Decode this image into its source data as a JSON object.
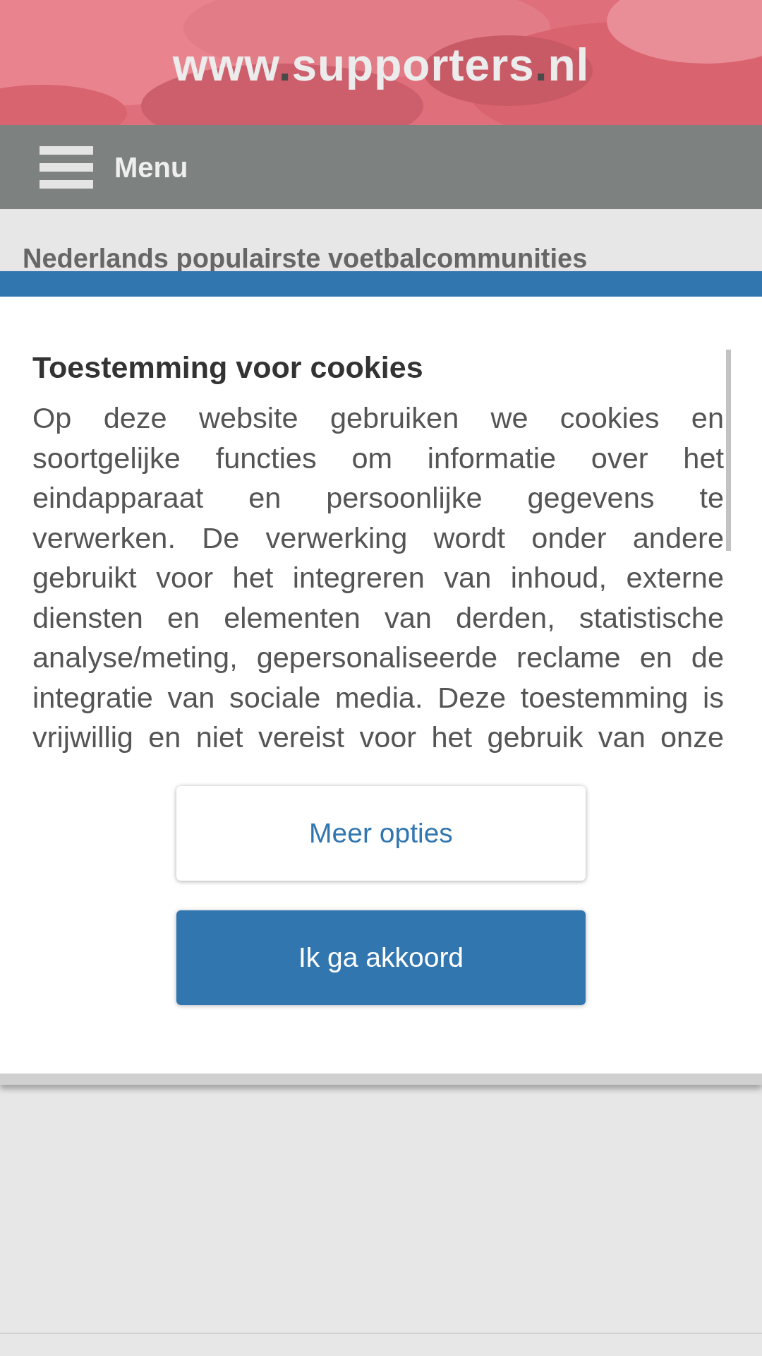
{
  "header": {
    "logo": "www.supporters.nl"
  },
  "nav": {
    "menu_label": "Menu"
  },
  "page": {
    "heading": "Nederlands populairste voetbalcommunities"
  },
  "cookie_dialog": {
    "title": "Toestemming voor cookies",
    "text": "Op deze website gebruiken we cookies en soortgelijke functies om informatie over het eindapparaat en persoonlijke gegevens te verwerken. De verwerking wordt onder andere gebruikt voor het integreren van inhoud, externe diensten en elementen van derden, statistische analyse/meting, gepersonaliseerde reclame en de integratie van sociale media. Deze toestemming is vrijwillig en niet vereist voor het gebruik van onze",
    "buttons": [
      {
        "label": "Meer opties",
        "kind": "secondary"
      },
      {
        "label": "Ik ga akkoord",
        "kind": "primary"
      }
    ]
  }
}
